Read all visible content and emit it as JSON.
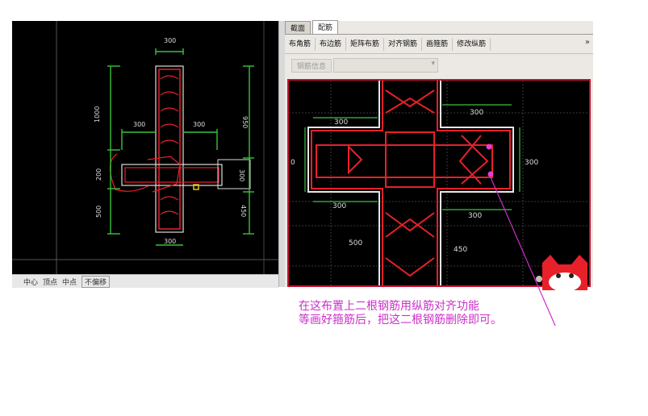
{
  "left_view": {
    "dims": {
      "top_width": "300",
      "left_arm": "300",
      "right_arm": "300",
      "height_top": "1000",
      "height_mid": "200",
      "height_bottom": "500",
      "right_top": "950",
      "right_mid": "300",
      "right_bottom": "450",
      "bottom_width": "300"
    },
    "status_items": [
      "中心",
      "顶点",
      "中点",
      "不偏移"
    ]
  },
  "right_panel": {
    "tabs": [
      {
        "label": "截面",
        "active": false
      },
      {
        "label": "配筋",
        "active": true
      }
    ],
    "toolbar": [
      "布角筋",
      "布边筋",
      "矩阵布筋",
      "对齐钢筋",
      "画箍筋",
      "修改纵筋"
    ],
    "toolbar_more": "»",
    "rebar_info_button": "钢筋信息",
    "dims": {
      "top": "300",
      "left": "300",
      "right": "300",
      "right_lower": "300",
      "left_lower": "300",
      "bottom_left": "500",
      "bottom_right": "450",
      "left_edge": "0"
    }
  },
  "annotation": {
    "line1": "在这布置上二根钢筋用纵筋对齐功能",
    "line2": "等画好箍筋后，把这二根钢筋删除即可。"
  },
  "colors": {
    "annotation": "#cc2fc9",
    "rebar": "#e8202a",
    "dimension": "#39c23c",
    "panel_border": "#c8102e"
  }
}
